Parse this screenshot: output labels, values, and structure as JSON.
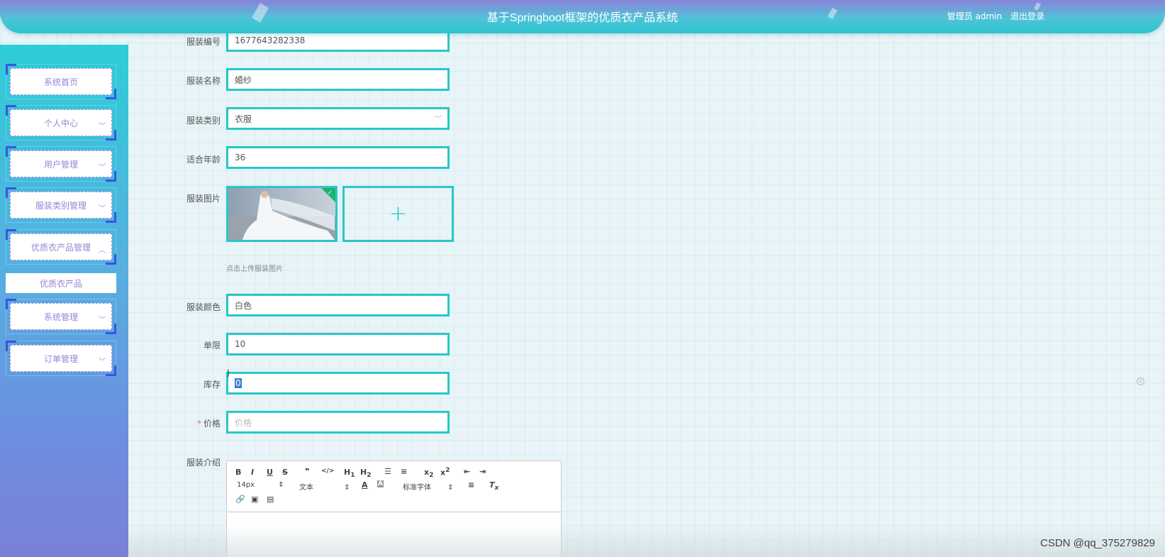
{
  "header": {
    "title": "基于Springboot框架的优质衣产品系统",
    "user": "管理员 admin",
    "logout": "退出登录"
  },
  "sidebar": {
    "items": [
      {
        "label": "系统首页",
        "has_arrow": false
      },
      {
        "label": "个人中心",
        "has_arrow": true
      },
      {
        "label": "用户管理",
        "has_arrow": true
      },
      {
        "label": "服装类别管理",
        "has_arrow": true
      },
      {
        "label": "优质衣产品管理",
        "has_arrow": true,
        "expanded": true
      },
      {
        "label": "系统管理",
        "has_arrow": true
      },
      {
        "label": "订单管理",
        "has_arrow": true
      }
    ],
    "submenu": "优质衣产品",
    "arrow_down": "﹀",
    "arrow_up": "︿"
  },
  "form": {
    "code_label": "服装编号",
    "code_value": "1677643282338",
    "name_label": "服装名称",
    "name_value": "婚纱",
    "category_label": "服装类别",
    "category_value": "衣服",
    "age_label": "适合年龄",
    "age_value": "36",
    "image_label": "服装图片",
    "image_tip": "点击上传服装图片",
    "color_label": "服装颜色",
    "color_value": "白色",
    "limit_label": "单限",
    "limit_value": "10",
    "stock_label": "库存",
    "stock_value": "0",
    "price_label": "价格",
    "price_placeholder": "价格",
    "price_required": "*",
    "intro_label": "服装介绍"
  },
  "editor": {
    "font_size": "14px",
    "text_type": "文本",
    "font_family": "标准字体"
  },
  "watermark": "CSDN @qq_375279829",
  "colors": {
    "accent": "#2cc6c9",
    "menu_text": "#9a82d6",
    "corner": "#3a55e0"
  }
}
